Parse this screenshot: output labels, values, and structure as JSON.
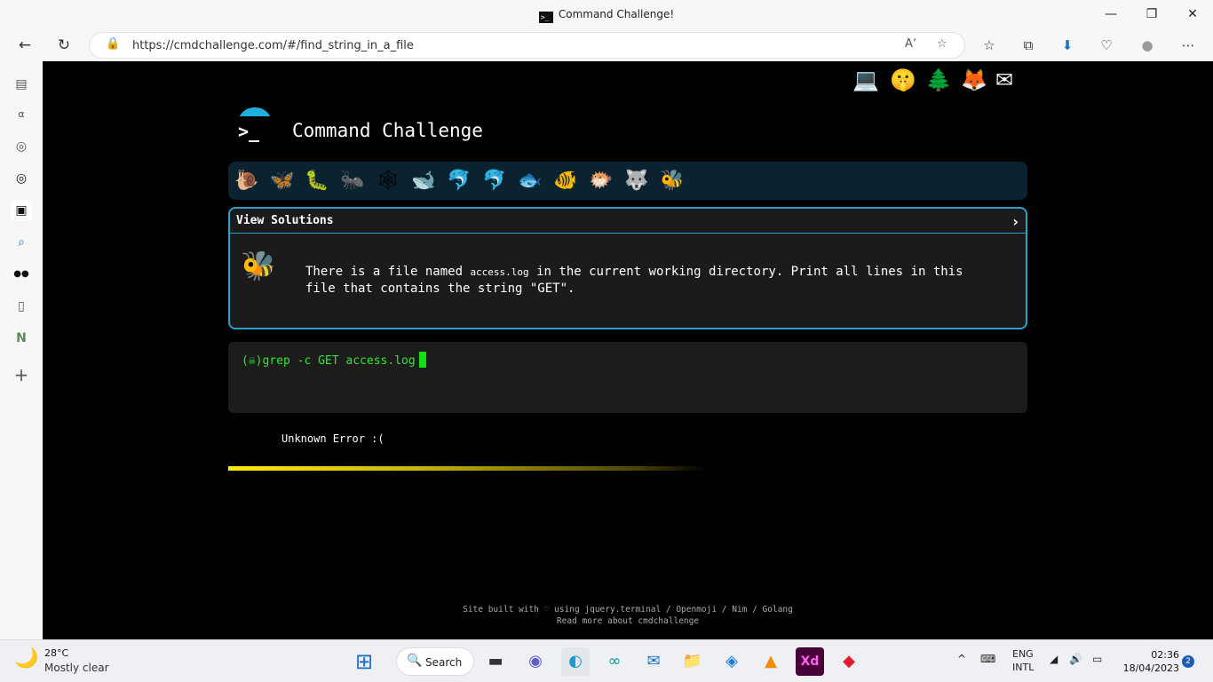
{
  "window": {
    "title": "Command Challenge!",
    "minimize": "—",
    "maximize": "❐",
    "close": "✕"
  },
  "nav": {
    "back_icon": "←",
    "refresh_icon": "↻",
    "url": "https://cmdchallenge.com/#/find_string_in_a_file",
    "lock_icon": "🔒",
    "read_aloud_icon": "Aʼ",
    "fav_add_icon": "☆",
    "favorites_icon": "☆",
    "collections_icon": "⧉",
    "downloads_icon": "⬇",
    "health_icon": "♡",
    "profile_icon": "●",
    "more_icon": "⋯"
  },
  "sidebar": {
    "icons": [
      "▤",
      "α",
      "◎",
      "◎",
      "▣",
      "⌕",
      "●●",
      "▯",
      "N",
      "+"
    ]
  },
  "page": {
    "top_icons": [
      "💻",
      "🤫",
      "🌲",
      "🦊",
      "✉"
    ],
    "logo_prompt": ">_",
    "app_title": "Command Challenge",
    "animals": [
      "🐌",
      "🦋",
      "🐛",
      "🐜",
      "🕸",
      "🐋",
      "🐬",
      "🐬",
      "🐟",
      "🐠",
      "🐡",
      "🐺",
      "🐝"
    ],
    "solutions_label": "View Solutions",
    "solutions_chevron": "›",
    "task_icon": "🐝",
    "description": {
      "part1": "There is a file named ",
      "filename": "access.log",
      "part2": " in the current working directory. Print all lines in this file that contains the string \"GET\"."
    },
    "prompt": "(☠)",
    "command": "grep -c GET access.log",
    "error_icon": "😿",
    "error_text": "Unknown Error :(",
    "progress": 0.6,
    "footer_line1": "Site built with ♡ using jquery.terminal / Openmoji / Nim / Golang",
    "footer_line2": "Read more about cmdchallenge"
  },
  "taskbar": {
    "weather_icon": "🌙",
    "temperature": "28°C",
    "weather": "Mostly clear",
    "start_icon": "⊞",
    "search_label": "Search",
    "search_icon": "🔍",
    "apps": [
      "▬",
      "◉",
      "◐",
      "∞",
      "✉",
      "📁",
      "◈",
      "▲",
      "Xd",
      "◆"
    ],
    "tray_chevron": "^",
    "keyboard_icon": "⌨",
    "lang1": "ENG",
    "lang2": "INTL",
    "wifi_icon": "◢",
    "volume_icon": "🔊",
    "battery_icon": "▭",
    "time": "02:36",
    "date": "18/04/2023",
    "notif_count": "2"
  }
}
